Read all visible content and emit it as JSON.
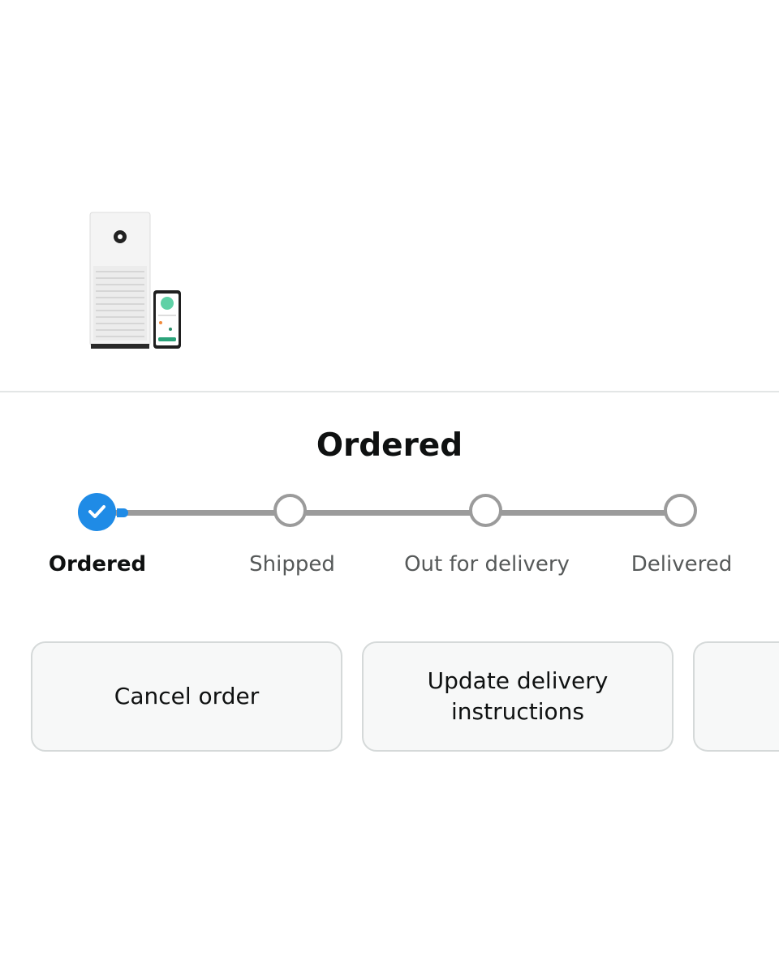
{
  "status": {
    "title": "Ordered"
  },
  "tracker": {
    "steps": [
      {
        "label": "Ordered",
        "state": "completed"
      },
      {
        "label": "Shipped",
        "state": "pending"
      },
      {
        "label": "Out for delivery",
        "state": "pending"
      },
      {
        "label": "Delivered",
        "state": "pending"
      }
    ],
    "progress_fraction": 0.0,
    "colors": {
      "completed": "#1f8be6",
      "pending": "#9b9b9b"
    }
  },
  "actions": {
    "cancel_label": "Cancel order",
    "update_label": "Update delivery instructions",
    "third_label": ""
  },
  "icons": {
    "step_done": "check-icon"
  }
}
